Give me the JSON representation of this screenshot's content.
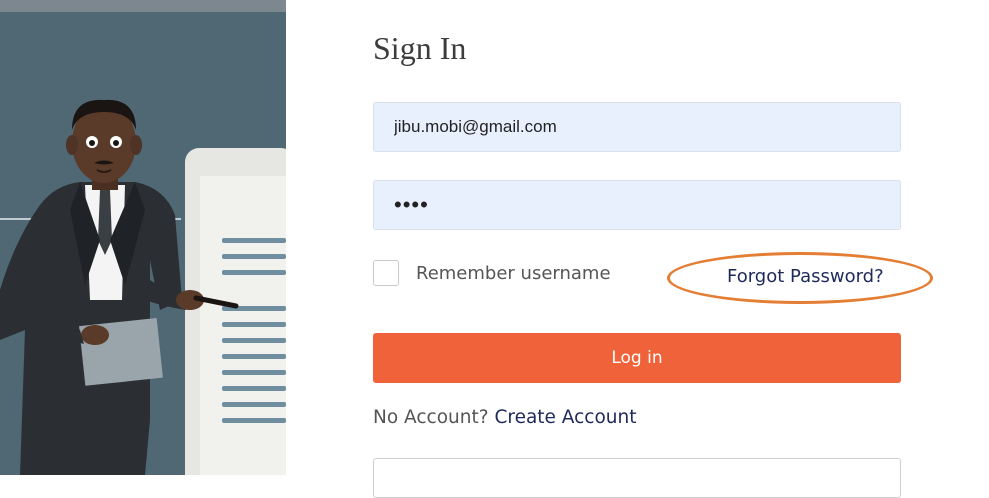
{
  "illustration": {
    "description_icon": "businessman-presenting-illustration"
  },
  "form": {
    "title": "Sign In",
    "email_value": "jibu.mobi@gmail.com",
    "password_value": "••••",
    "remember_label": "Remember username",
    "remember_checked": false,
    "forgot_label": "Forgot Password?",
    "login_label": "Log in",
    "no_account_text": "No Account?",
    "create_account_label": "Create Account"
  },
  "colors": {
    "accent": "#f0623a",
    "highlight_ring": "#e47e34",
    "link": "#1e2a5a",
    "input_fill": "#e8f0fe"
  }
}
